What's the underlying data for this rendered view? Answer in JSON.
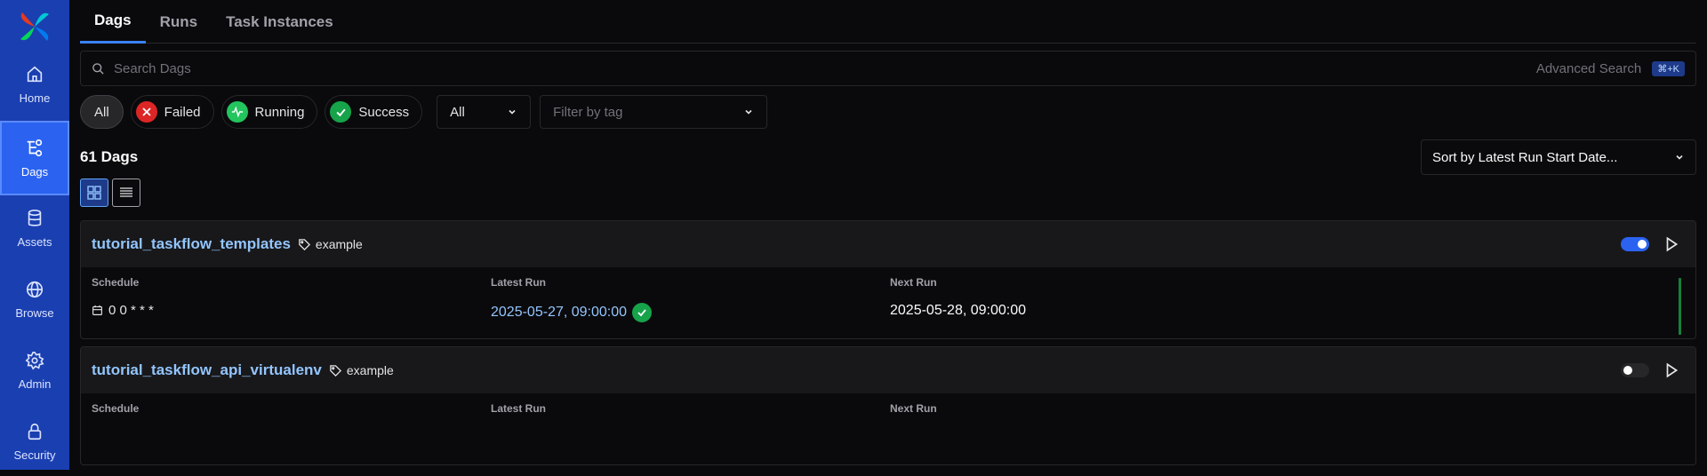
{
  "sidebar": {
    "items": [
      {
        "label": "Home",
        "icon": "home-icon"
      },
      {
        "label": "Dags",
        "icon": "dags-icon"
      },
      {
        "label": "Assets",
        "icon": "database-icon"
      },
      {
        "label": "Browse",
        "icon": "globe-icon"
      },
      {
        "label": "Admin",
        "icon": "gear-icon"
      },
      {
        "label": "Security",
        "icon": "lock-icon"
      }
    ]
  },
  "tabs": [
    "Dags",
    "Runs",
    "Task Instances"
  ],
  "search": {
    "placeholder": "Search Dags",
    "advanced": "Advanced Search",
    "shortcut": "⌘+K"
  },
  "filters": {
    "all": "All",
    "failed": "Failed",
    "running": "Running",
    "success": "Success",
    "paused_select": "All",
    "tag_placeholder": "Filter by tag"
  },
  "dag_count": "61 Dags",
  "sort_label": "Sort by Latest Run Start Date...",
  "column_headers": {
    "schedule": "Schedule",
    "latest_run": "Latest Run",
    "next_run": "Next Run"
  },
  "colors": {
    "accent": "#3b82f6",
    "success": "#16a34a",
    "failed": "#dc2626",
    "running": "#22c55e",
    "sidebar": "#1a3fb0"
  },
  "dags": [
    {
      "name": "tutorial_taskflow_templates",
      "tag": "example",
      "enabled": true,
      "schedule": "0 0 * * *",
      "latest_run": "2025-05-27, 09:00:00",
      "latest_run_state": "success",
      "next_run": "2025-05-28, 09:00:00"
    },
    {
      "name": "tutorial_taskflow_api_virtualenv",
      "tag": "example",
      "enabled": false,
      "schedule": "",
      "latest_run": "",
      "next_run": ""
    }
  ]
}
